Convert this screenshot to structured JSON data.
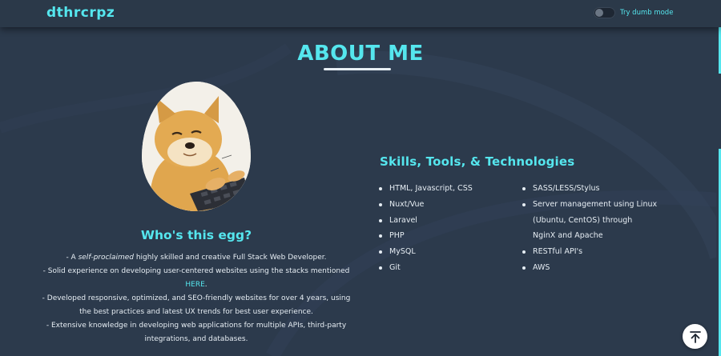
{
  "nav": {
    "brand": "dthrcrpz",
    "toggle_label": "Try dumb mode"
  },
  "about": {
    "title": "ABOUT ME",
    "who_title": "Who's this egg?",
    "line1_prefix": "- A ",
    "line1_em": "self-proclaimed",
    "line1_suffix": " highly skilled and creative Full Stack Web Developer.",
    "line2a": "- Solid experience on developing user-centered websites using the stacks mentioned",
    "line2_link": "HERE",
    "line2_end": ".",
    "line3a": "- Developed responsive, optimized, and SEO-friendly websites for over 4 years, using",
    "line3b": "the best practices and latest UX trends for best user experience.",
    "line4a": "- Extensive knowledge in developing web applications for multiple APIs, third-party",
    "line4b": "integrations, and databases."
  },
  "skills": {
    "title": "Skills, Tools, & Technologies",
    "col1": [
      "HTML, Javascript, CSS",
      "Nuxt/Vue",
      "Laravel",
      "PHP",
      "MySQL",
      "Git"
    ],
    "col2_a": "SASS/LESS/Stylus",
    "col2_b1": "Server management using Linux",
    "col2_b2": "(Ubuntu, CentOS) through",
    "col2_b3": "NginX and Apache",
    "col2_c": "RESTful API's",
    "col2_d": "AWS"
  },
  "icons": {
    "toggle": "toggle-switch",
    "back_to_top": "arrow-up-to-line-icon",
    "avatar": "doge-typing-image"
  },
  "colors": {
    "background": "#2c3a4c",
    "accent": "#55e6ee",
    "text": "#e6edf3"
  }
}
